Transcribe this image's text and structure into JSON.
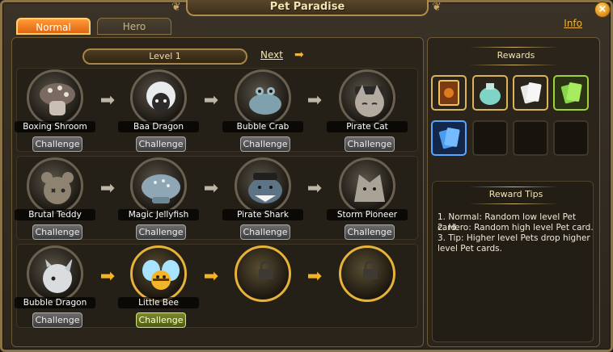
{
  "window": {
    "title": "Pet Paradise",
    "close_label": "×",
    "info_label": "Info"
  },
  "tabs": [
    {
      "label": "Normal",
      "active": true
    },
    {
      "label": "Hero",
      "active": false
    }
  ],
  "level": {
    "label": "Level 1",
    "next_label": "Next",
    "next_arrow": "➡"
  },
  "pets": [
    {
      "name": "Boxing Shroom",
      "challenge": "Challenge",
      "icon": "mushroom-icon"
    },
    {
      "name": "Baa Dragon",
      "challenge": "Challenge",
      "icon": "sheep-icon"
    },
    {
      "name": "Bubble Crab",
      "challenge": "Challenge",
      "icon": "crab-icon"
    },
    {
      "name": "Pirate Cat",
      "challenge": "Challenge",
      "icon": "cat-icon"
    },
    {
      "name": "Brutal Teddy",
      "challenge": "Challenge",
      "icon": "teddy-icon"
    },
    {
      "name": "Magic Jellyfish",
      "challenge": "Challenge",
      "icon": "jellyfish-icon"
    },
    {
      "name": "Pirate Shark",
      "challenge": "Challenge",
      "icon": "shark-icon"
    },
    {
      "name": "Storm Pioneer",
      "challenge": "Challenge",
      "icon": "wolf-icon"
    },
    {
      "name": "Bubble Dragon",
      "challenge": "Challenge",
      "icon": "dragon-icon"
    },
    {
      "name": "Little Bee",
      "challenge": "Challenge",
      "icon": "bee-icon",
      "selected": true
    }
  ],
  "locked_slots": 2,
  "arrow_glyph": "➡",
  "rewards": {
    "heading": "Rewards",
    "items": [
      "scroll-card-icon",
      "potion-bag-icon",
      "card-pack-icon",
      "green-card-pack-icon",
      "blue-card-pack-icon"
    ],
    "empty_slots": 3
  },
  "tips": {
    "heading": "Reward Tips",
    "lines": [
      "1. Normal: Random low level Pet card.",
      "2. Hero: Random high level Pet card.",
      "3. Tip: Higher level Pets drop higher level Pet cards."
    ]
  }
}
